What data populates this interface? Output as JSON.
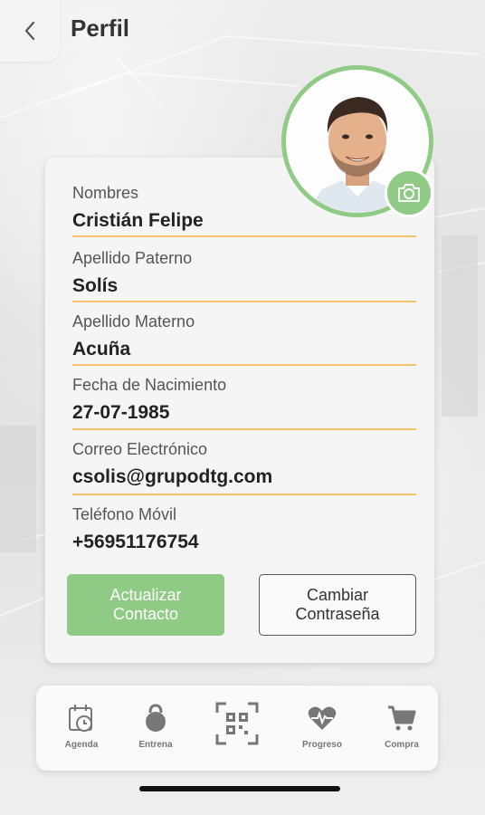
{
  "header": {
    "title": "Perfil"
  },
  "profile": {
    "fields": [
      {
        "label": "Nombres",
        "value": "Cristián Felipe"
      },
      {
        "label": "Apellido Paterno",
        "value": "Solís"
      },
      {
        "label": "Apellido Materno",
        "value": "Acuña"
      },
      {
        "label": "Fecha de Nacimiento",
        "value": "27-07-1985"
      },
      {
        "label": "Correo Electrónico",
        "value": "csolis@grupodtg.com"
      },
      {
        "label": "Teléfono Móvil",
        "value": "+56951176754"
      }
    ],
    "update_contact_label": "Actualizar Contacto",
    "change_password_label": "Cambiar Contraseña"
  },
  "tabbar": {
    "items": [
      {
        "label": "Agenda",
        "icon": "calendar-clock-icon"
      },
      {
        "label": "Entrena",
        "icon": "kettlebell-icon"
      },
      {
        "label": "",
        "icon": "qr-code-icon"
      },
      {
        "label": "Progreso",
        "icon": "heart-pulse-icon"
      },
      {
        "label": "Compra",
        "icon": "cart-icon"
      }
    ]
  },
  "colors": {
    "accent": "#8fcb85",
    "divider": "#f2c46b",
    "text": "#222222"
  }
}
